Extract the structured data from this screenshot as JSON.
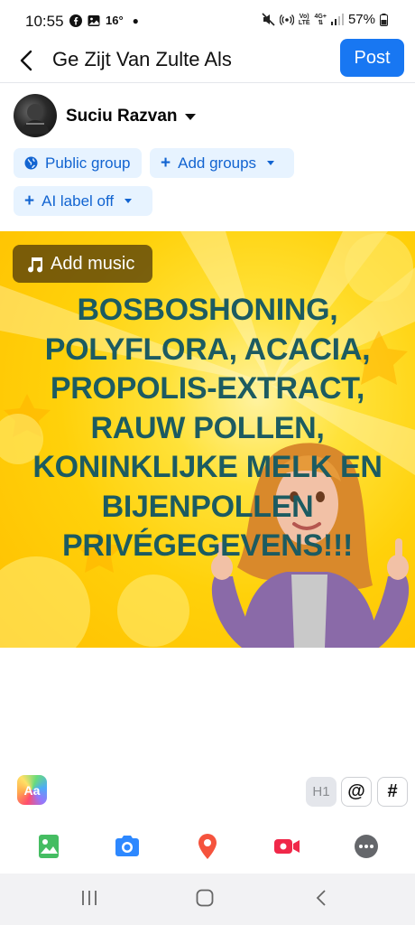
{
  "status_bar": {
    "time": "10:55",
    "temperature": "16°",
    "network_volte": "Vo)",
    "network_lte": "LTE",
    "network_4g": "4G+",
    "battery": "57%"
  },
  "header": {
    "title": "Ge Zijt Van Zulte Als",
    "post_label": "Post"
  },
  "author": {
    "name": "Suciu Razvan"
  },
  "chips": {
    "audience": "Public group",
    "add_groups": "Add groups",
    "ai_label": "AI label off"
  },
  "post": {
    "add_music_label": "Add music",
    "lines": [
      "BOSBOSHONING,",
      "POLYFLORA, ACACIA,",
      "PROPOLIS-EXTRACT,",
      "RAUW POLLEN,",
      "KONINKLIJKE MELK EN",
      "BIJENPOLLEN",
      "PRIVÉGEGEVENS!!!"
    ],
    "text_color": "#1c5b61",
    "background_color": "#ffd10a"
  },
  "composer": {
    "aa_label": "Aa",
    "h1_label": "H1",
    "mention_label": "@",
    "hashtag_label": "#"
  },
  "actions": [
    "photo-icon",
    "camera-icon",
    "location-icon",
    "video-icon",
    "more-icon"
  ],
  "colors": {
    "accent": "#1877f2",
    "chip_bg": "#e7f3ff",
    "chip_text": "#1264d1"
  }
}
